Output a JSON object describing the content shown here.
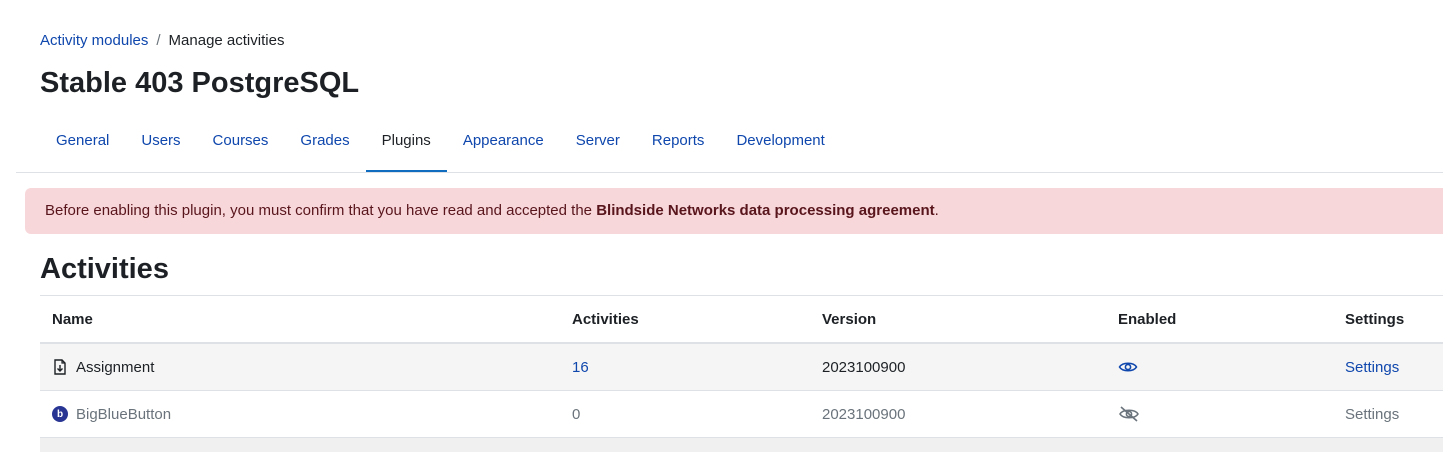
{
  "breadcrumb": {
    "parent": "Activity modules",
    "separator": "/",
    "current": "Manage activities"
  },
  "page_title": "Stable 403 PostgreSQL",
  "tabs": [
    {
      "label": "General"
    },
    {
      "label": "Users"
    },
    {
      "label": "Courses"
    },
    {
      "label": "Grades"
    },
    {
      "label": "Plugins",
      "active": true
    },
    {
      "label": "Appearance"
    },
    {
      "label": "Server"
    },
    {
      "label": "Reports"
    },
    {
      "label": "Development"
    }
  ],
  "alert": {
    "text_before": "Before enabling this plugin, you must confirm that you have read and accepted the ",
    "bold_text": "Blindside Networks data processing agreement",
    "text_after": "."
  },
  "section_title": "Activities",
  "table": {
    "headers": {
      "name": "Name",
      "activities": "Activities",
      "version": "Version",
      "enabled": "Enabled",
      "settings": "Settings"
    },
    "rows": [
      {
        "name": "Assignment",
        "icon": "assignment-icon",
        "activities": "16",
        "version": "2023100900",
        "enabled": "eye-icon",
        "settings": "Settings"
      },
      {
        "name": "BigBlueButton",
        "icon": "bigbluebutton-icon",
        "icon_glyph": "b",
        "activities": "0",
        "version": "2023100900",
        "enabled": "eye-slash-icon",
        "settings": "Settings"
      }
    ]
  },
  "colors": {
    "link": "#0f47ad",
    "alert_bg": "#f8d7da",
    "alert_text": "#58151c",
    "active_tab_underline": "#0f6cbf"
  }
}
